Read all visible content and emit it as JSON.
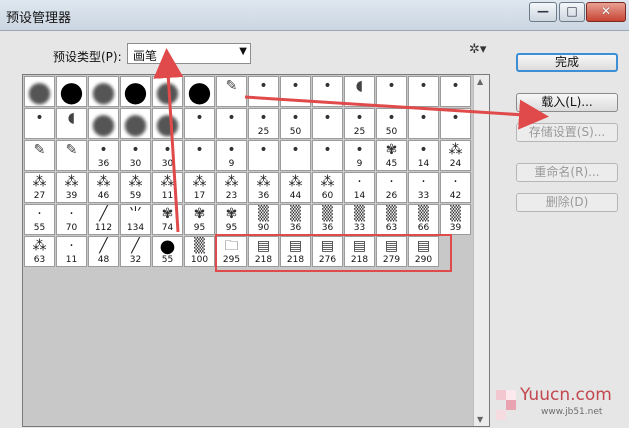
{
  "window": {
    "title": "预设管理器",
    "min_glyph": "—",
    "max_glyph": "□",
    "close_glyph": "✕"
  },
  "preset_type": {
    "label": "预设类型(P):",
    "value": "画笔",
    "arrow": "▼"
  },
  "gear": "✲▾",
  "buttons": {
    "done": "完成",
    "load": "载入(L)...",
    "save": "存储设置(S)...",
    "rename": "重命名(R)...",
    "delete": "删除(D)"
  },
  "scroll": {
    "up": "▲",
    "down": "▼"
  },
  "brushes": [
    [
      "soft-round",
      "",
      "round"
    ],
    [
      "hard-round",
      "",
      "round"
    ],
    [
      "soft-round",
      "",
      "round"
    ],
    [
      "hard-round",
      "",
      "round"
    ],
    [
      "soft-round",
      "",
      "round"
    ],
    [
      "hard-round",
      "",
      "round"
    ],
    [
      "pencil-tip",
      "",
      "tool"
    ],
    [
      "tool-tip",
      "",
      "tool"
    ],
    [
      "tool-tip",
      "",
      "tool"
    ],
    [
      "tool-tip",
      "",
      "tool"
    ],
    [
      "fan-tip",
      "",
      "tool"
    ],
    [
      "tool-tip",
      "",
      "tool"
    ],
    [
      "tool-tip",
      "",
      "tool"
    ],
    [
      "tool-tip",
      "",
      "tool"
    ],
    [
      "tool-tip",
      "",
      "tool"
    ],
    [
      "fan-tip",
      "",
      "tool"
    ],
    [
      "soft-round",
      "",
      "round"
    ],
    [
      "soft-round",
      "",
      "round"
    ],
    [
      "soft-round",
      "",
      "round"
    ],
    [
      "tool-tip",
      "",
      "tool"
    ],
    [
      "tool-tip",
      "",
      "tool"
    ],
    [
      "tool-tip",
      "25",
      "tool"
    ],
    [
      "tool-tip",
      "50",
      "tool"
    ],
    [
      "tool-tip",
      "",
      "tool"
    ],
    [
      "tool-tip",
      "25",
      "tool"
    ],
    [
      "tool-tip",
      "50",
      "tool"
    ],
    [
      "tool-tip",
      "",
      "tool"
    ],
    [
      "tool-tip",
      "",
      "tool"
    ],
    [
      "pencil-tip",
      "",
      "tool"
    ],
    [
      "pencil-tip",
      "",
      "tool"
    ],
    [
      "tool-tip",
      "36",
      "tool"
    ],
    [
      "tool-tip",
      "30",
      "tool"
    ],
    [
      "tool-tip",
      "30",
      "tool"
    ],
    [
      "tool-tip",
      "",
      "tool"
    ],
    [
      "tool-tip",
      "9",
      "tool"
    ],
    [
      "tool-tip",
      "",
      "tool"
    ],
    [
      "tool-tip",
      "",
      "tool"
    ],
    [
      "tool-tip",
      "",
      "tool"
    ],
    [
      "tool-tip",
      "9",
      "tool"
    ],
    [
      "leaf",
      "45",
      "shape"
    ],
    [
      "tool-tip",
      "14",
      "tool"
    ],
    [
      "scatter",
      "24",
      "scatter"
    ],
    [
      "scatter",
      "27",
      "scatter"
    ],
    [
      "scatter",
      "39",
      "scatter"
    ],
    [
      "scatter",
      "46",
      "scatter"
    ],
    [
      "scatter",
      "59",
      "scatter"
    ],
    [
      "scatter",
      "11",
      "scatter"
    ],
    [
      "scatter",
      "17",
      "scatter"
    ],
    [
      "scatter",
      "23",
      "scatter"
    ],
    [
      "scatter",
      "36",
      "scatter"
    ],
    [
      "scatter",
      "44",
      "scatter"
    ],
    [
      "scatter",
      "60",
      "scatter"
    ],
    [
      "dot",
      "14",
      "dot"
    ],
    [
      "dot",
      "26",
      "dot"
    ],
    [
      "dot",
      "33",
      "dot"
    ],
    [
      "dot",
      "42",
      "dot"
    ],
    [
      "dot",
      "55",
      "dot"
    ],
    [
      "dot",
      "70",
      "dot"
    ],
    [
      "stroke",
      "112",
      "stroke"
    ],
    [
      "grass",
      "134",
      "stroke"
    ],
    [
      "leaf",
      "74",
      "shape"
    ],
    [
      "leaf",
      "95",
      "shape"
    ],
    [
      "leaf",
      "95",
      "shape"
    ],
    [
      "texture",
      "90",
      "texture"
    ],
    [
      "texture",
      "36",
      "texture"
    ],
    [
      "texture",
      "36",
      "texture"
    ],
    [
      "texture",
      "33",
      "texture"
    ],
    [
      "texture",
      "63",
      "texture"
    ],
    [
      "texture",
      "66",
      "texture"
    ],
    [
      "texture",
      "39",
      "texture"
    ],
    [
      "scatter",
      "63",
      "scatter"
    ],
    [
      "dot",
      "11",
      "dot"
    ],
    [
      "stroke",
      "48",
      "stroke"
    ],
    [
      "stroke",
      "32",
      "stroke"
    ],
    [
      "hard-round",
      "55",
      "round"
    ],
    [
      "texture",
      "100",
      "texture"
    ],
    [
      "folder",
      "295",
      "doc"
    ],
    [
      "document",
      "218",
      "doc"
    ],
    [
      "document",
      "218",
      "doc"
    ],
    [
      "document",
      "276",
      "doc"
    ],
    [
      "document",
      "218",
      "doc"
    ],
    [
      "document",
      "279",
      "doc"
    ],
    [
      "document",
      "290",
      "doc"
    ]
  ],
  "watermark": {
    "text": "Yuucn.com",
    "sub": "www.jb51.net"
  }
}
